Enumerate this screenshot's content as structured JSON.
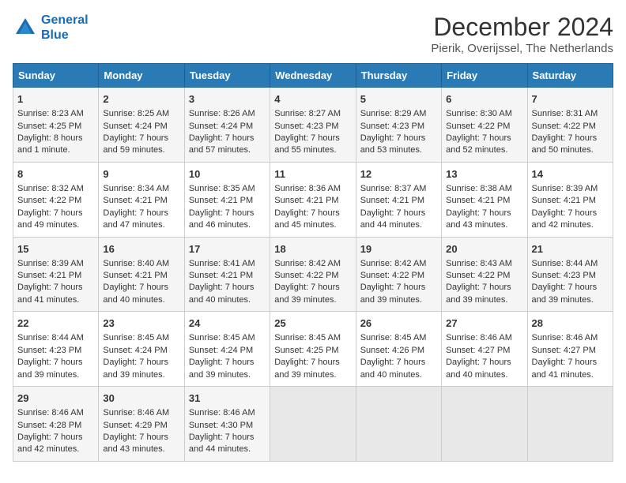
{
  "header": {
    "logo_line1": "General",
    "logo_line2": "Blue",
    "month": "December 2024",
    "location": "Pierik, Overijssel, The Netherlands"
  },
  "weekdays": [
    "Sunday",
    "Monday",
    "Tuesday",
    "Wednesday",
    "Thursday",
    "Friday",
    "Saturday"
  ],
  "weeks": [
    [
      {
        "day": "1",
        "lines": [
          "Sunrise: 8:23 AM",
          "Sunset: 4:25 PM",
          "Daylight: 8 hours",
          "and 1 minute."
        ]
      },
      {
        "day": "2",
        "lines": [
          "Sunrise: 8:25 AM",
          "Sunset: 4:24 PM",
          "Daylight: 7 hours",
          "and 59 minutes."
        ]
      },
      {
        "day": "3",
        "lines": [
          "Sunrise: 8:26 AM",
          "Sunset: 4:24 PM",
          "Daylight: 7 hours",
          "and 57 minutes."
        ]
      },
      {
        "day": "4",
        "lines": [
          "Sunrise: 8:27 AM",
          "Sunset: 4:23 PM",
          "Daylight: 7 hours",
          "and 55 minutes."
        ]
      },
      {
        "day": "5",
        "lines": [
          "Sunrise: 8:29 AM",
          "Sunset: 4:23 PM",
          "Daylight: 7 hours",
          "and 53 minutes."
        ]
      },
      {
        "day": "6",
        "lines": [
          "Sunrise: 8:30 AM",
          "Sunset: 4:22 PM",
          "Daylight: 7 hours",
          "and 52 minutes."
        ]
      },
      {
        "day": "7",
        "lines": [
          "Sunrise: 8:31 AM",
          "Sunset: 4:22 PM",
          "Daylight: 7 hours",
          "and 50 minutes."
        ]
      }
    ],
    [
      {
        "day": "8",
        "lines": [
          "Sunrise: 8:32 AM",
          "Sunset: 4:22 PM",
          "Daylight: 7 hours",
          "and 49 minutes."
        ]
      },
      {
        "day": "9",
        "lines": [
          "Sunrise: 8:34 AM",
          "Sunset: 4:21 PM",
          "Daylight: 7 hours",
          "and 47 minutes."
        ]
      },
      {
        "day": "10",
        "lines": [
          "Sunrise: 8:35 AM",
          "Sunset: 4:21 PM",
          "Daylight: 7 hours",
          "and 46 minutes."
        ]
      },
      {
        "day": "11",
        "lines": [
          "Sunrise: 8:36 AM",
          "Sunset: 4:21 PM",
          "Daylight: 7 hours",
          "and 45 minutes."
        ]
      },
      {
        "day": "12",
        "lines": [
          "Sunrise: 8:37 AM",
          "Sunset: 4:21 PM",
          "Daylight: 7 hours",
          "and 44 minutes."
        ]
      },
      {
        "day": "13",
        "lines": [
          "Sunrise: 8:38 AM",
          "Sunset: 4:21 PM",
          "Daylight: 7 hours",
          "and 43 minutes."
        ]
      },
      {
        "day": "14",
        "lines": [
          "Sunrise: 8:39 AM",
          "Sunset: 4:21 PM",
          "Daylight: 7 hours",
          "and 42 minutes."
        ]
      }
    ],
    [
      {
        "day": "15",
        "lines": [
          "Sunrise: 8:39 AM",
          "Sunset: 4:21 PM",
          "Daylight: 7 hours",
          "and 41 minutes."
        ]
      },
      {
        "day": "16",
        "lines": [
          "Sunrise: 8:40 AM",
          "Sunset: 4:21 PM",
          "Daylight: 7 hours",
          "and 40 minutes."
        ]
      },
      {
        "day": "17",
        "lines": [
          "Sunrise: 8:41 AM",
          "Sunset: 4:21 PM",
          "Daylight: 7 hours",
          "and 40 minutes."
        ]
      },
      {
        "day": "18",
        "lines": [
          "Sunrise: 8:42 AM",
          "Sunset: 4:22 PM",
          "Daylight: 7 hours",
          "and 39 minutes."
        ]
      },
      {
        "day": "19",
        "lines": [
          "Sunrise: 8:42 AM",
          "Sunset: 4:22 PM",
          "Daylight: 7 hours",
          "and 39 minutes."
        ]
      },
      {
        "day": "20",
        "lines": [
          "Sunrise: 8:43 AM",
          "Sunset: 4:22 PM",
          "Daylight: 7 hours",
          "and 39 minutes."
        ]
      },
      {
        "day": "21",
        "lines": [
          "Sunrise: 8:44 AM",
          "Sunset: 4:23 PM",
          "Daylight: 7 hours",
          "and 39 minutes."
        ]
      }
    ],
    [
      {
        "day": "22",
        "lines": [
          "Sunrise: 8:44 AM",
          "Sunset: 4:23 PM",
          "Daylight: 7 hours",
          "and 39 minutes."
        ]
      },
      {
        "day": "23",
        "lines": [
          "Sunrise: 8:45 AM",
          "Sunset: 4:24 PM",
          "Daylight: 7 hours",
          "and 39 minutes."
        ]
      },
      {
        "day": "24",
        "lines": [
          "Sunrise: 8:45 AM",
          "Sunset: 4:24 PM",
          "Daylight: 7 hours",
          "and 39 minutes."
        ]
      },
      {
        "day": "25",
        "lines": [
          "Sunrise: 8:45 AM",
          "Sunset: 4:25 PM",
          "Daylight: 7 hours",
          "and 39 minutes."
        ]
      },
      {
        "day": "26",
        "lines": [
          "Sunrise: 8:45 AM",
          "Sunset: 4:26 PM",
          "Daylight: 7 hours",
          "and 40 minutes."
        ]
      },
      {
        "day": "27",
        "lines": [
          "Sunrise: 8:46 AM",
          "Sunset: 4:27 PM",
          "Daylight: 7 hours",
          "and 40 minutes."
        ]
      },
      {
        "day": "28",
        "lines": [
          "Sunrise: 8:46 AM",
          "Sunset: 4:27 PM",
          "Daylight: 7 hours",
          "and 41 minutes."
        ]
      }
    ],
    [
      {
        "day": "29",
        "lines": [
          "Sunrise: 8:46 AM",
          "Sunset: 4:28 PM",
          "Daylight: 7 hours",
          "and 42 minutes."
        ]
      },
      {
        "day": "30",
        "lines": [
          "Sunrise: 8:46 AM",
          "Sunset: 4:29 PM",
          "Daylight: 7 hours",
          "and 43 minutes."
        ]
      },
      {
        "day": "31",
        "lines": [
          "Sunrise: 8:46 AM",
          "Sunset: 4:30 PM",
          "Daylight: 7 hours",
          "and 44 minutes."
        ]
      },
      null,
      null,
      null,
      null
    ]
  ]
}
